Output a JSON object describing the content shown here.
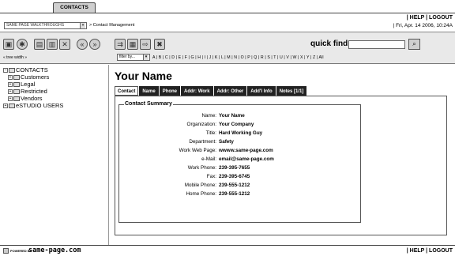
{
  "app": {
    "active_tab": "CONTACTS",
    "help_text": "| HELP | LOGOUT"
  },
  "header": {
    "walkthrough_select": "SAME PAGE WALKTHROUGHS",
    "breadcrumb": "> Contact Management",
    "date": "| Fri, Apr. 14 2006, 10:24A"
  },
  "toolbar": {
    "quick_find_label": "quick find:",
    "quick_find_value": "",
    "tree_width": "« tree width »",
    "filter_label": "filter by...",
    "alphabet": "A | B | C | D | E | F | G | H | I | J | K | L | M | N | O | P | Q | R | S | T | U | V | W | X | Y | Z | All"
  },
  "sidebar": {
    "items": [
      {
        "label": "CONTACTS",
        "expander": "⊟",
        "selected": false
      },
      {
        "label": "Customers",
        "expander": "+",
        "selected": false
      },
      {
        "label": "Legal",
        "expander": "+",
        "selected": false
      },
      {
        "label": "Restricted",
        "expander": "+",
        "selected": true
      },
      {
        "label": "Vendors",
        "expander": "+",
        "selected": false
      },
      {
        "label": "eSTUDIO USERS",
        "expander": "+",
        "selected": false
      }
    ]
  },
  "main": {
    "title": "Your Name",
    "tabs": [
      {
        "label": "Contact",
        "active": true
      },
      {
        "label": "Name",
        "active": false
      },
      {
        "label": "Phone",
        "active": false
      },
      {
        "label": "Addr: Work",
        "active": false
      },
      {
        "label": "Addr: Other",
        "active": false
      },
      {
        "label": "Add'l Info",
        "active": false
      },
      {
        "label": "Notes [1/1]",
        "active": false
      }
    ],
    "summary_legend": "Contact Summary",
    "fields": [
      {
        "label": "Name:",
        "value": "Your Name"
      },
      {
        "label": "Organization:",
        "value": "Your Company"
      },
      {
        "label": "Title:",
        "value": "Hard Working Guy"
      },
      {
        "label": "Department:",
        "value": "Safety"
      },
      {
        "label": "Work Web Page:",
        "value": "wwww.same-page.com"
      },
      {
        "label": "e-Mail:",
        "value": "email@same-page.com"
      },
      {
        "label": "Work Phone:",
        "value": "239-395-7655"
      },
      {
        "label": "Fax:",
        "value": "239-395-6745"
      },
      {
        "label": "Mobile Phone:",
        "value": "239-555-1212"
      },
      {
        "label": "Home Phone:",
        "value": "239-555-1212"
      }
    ]
  },
  "footer": {
    "powered_by": "POWERED BY",
    "brand": "same-page.com",
    "help_text": "| HELP | LOGOUT"
  }
}
